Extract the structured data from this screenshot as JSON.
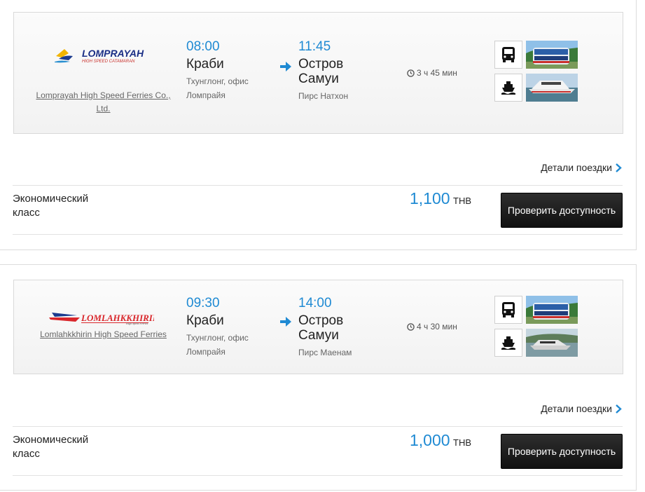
{
  "results": [
    {
      "operator": {
        "name": "Lomprayah High Speed Ferries Co., Ltd.",
        "logo_text": "LOMPRAYAH",
        "logo_subtext": "HIGH SPEED CATAMARAN"
      },
      "departure": {
        "time": "08:00",
        "city": "Краби",
        "place": "Тхунглонг, офис Ломпрайя"
      },
      "arrival": {
        "time": "11:45",
        "city": "Остров Самуи",
        "place": "Пирс Натхон"
      },
      "duration": "3 ч 45 мин",
      "modes": [
        "bus-icon",
        "ferry-icon"
      ],
      "details_label": "Детали поездки",
      "fare": {
        "class": "Экономический класс",
        "price": "1,100",
        "currency": "THB",
        "button": "Проверить доступность"
      }
    },
    {
      "operator": {
        "name": "Lomlahkkhirin High Speed Ferries",
        "logo_text": "LOMLAHKKHIRIN",
        "logo_subtext": "High Speed Ferries"
      },
      "departure": {
        "time": "09:30",
        "city": "Краби",
        "place": "Тхунглонг, офис Ломпрайя"
      },
      "arrival": {
        "time": "14:00",
        "city": "Остров Самуи",
        "place": "Пирс Маенам"
      },
      "duration": "4 ч 30 мин",
      "modes": [
        "bus-icon",
        "ferry-icon"
      ],
      "details_label": "Детали поездки",
      "fare": {
        "class": "Экономический класс",
        "price": "1,000",
        "currency": "THB",
        "button": "Проверить доступность"
      }
    }
  ],
  "colors": {
    "accent": "#1f8ad3",
    "button": "#1a1a1a"
  }
}
